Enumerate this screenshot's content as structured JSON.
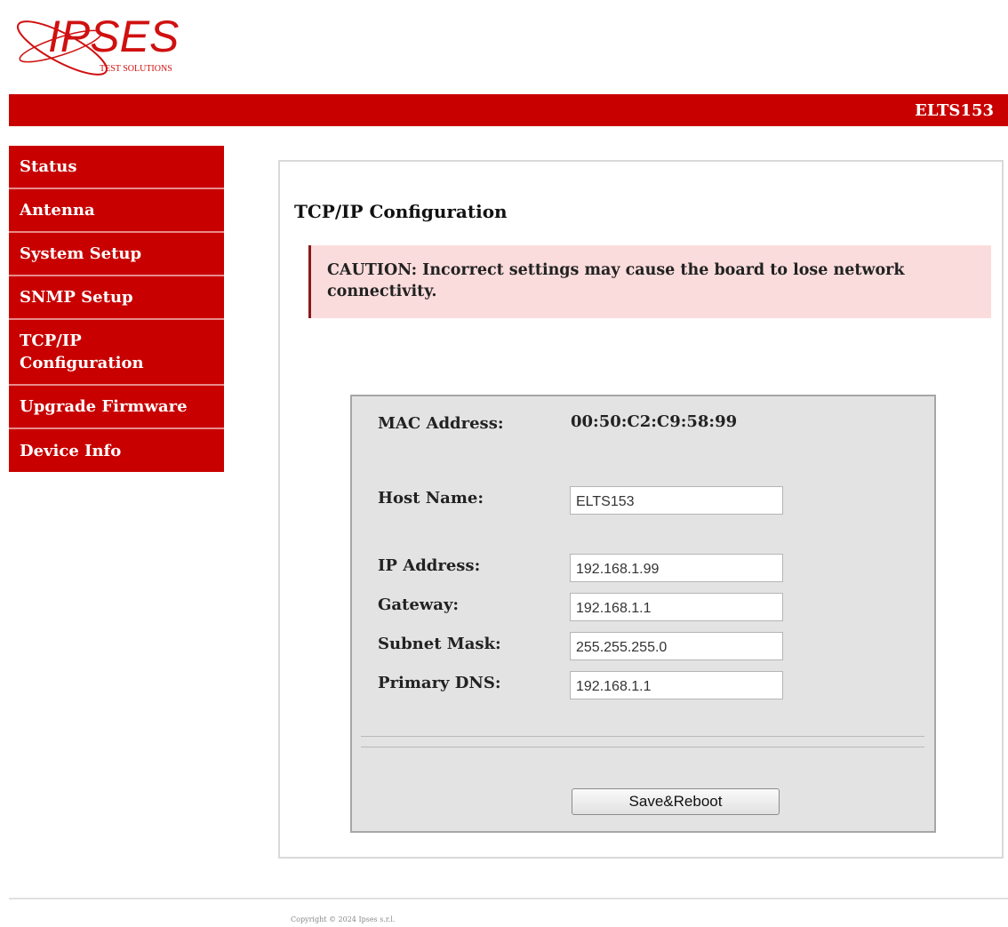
{
  "brand": {
    "logo_name": "IPSES",
    "logo_tagline": "TEST SOLUTIONS",
    "primary_color": "#c80000"
  },
  "header": {
    "device_name": "ELTS153"
  },
  "sidebar": {
    "items": [
      {
        "label": "Status"
      },
      {
        "label": "Antenna"
      },
      {
        "label": "System Setup"
      },
      {
        "label": "SNMP Setup"
      },
      {
        "label": "TCP/IP Configuration"
      },
      {
        "label": "Upgrade Firmware"
      },
      {
        "label": "Device Info"
      }
    ]
  },
  "main": {
    "title": "TCP/IP Configuration",
    "caution": "CAUTION: Incorrect settings may cause the board to lose network connectivity.",
    "form": {
      "mac_label": "MAC Address:",
      "mac_value": "00:50:C2:C9:58:99",
      "host_label": "Host Name:",
      "host_value": "ELTS153",
      "ip_label": "IP Address:",
      "ip_value": "192.168.1.99",
      "gateway_label": "Gateway:",
      "gateway_value": "192.168.1.1",
      "subnet_label": "Subnet Mask:",
      "subnet_value": "255.255.255.0",
      "dns_label": "Primary DNS:",
      "dns_value": "192.168.1.1",
      "save_label": "Save&Reboot"
    }
  },
  "footer": {
    "copyright": "Copyright © 2024 Ipses s.r.l."
  }
}
